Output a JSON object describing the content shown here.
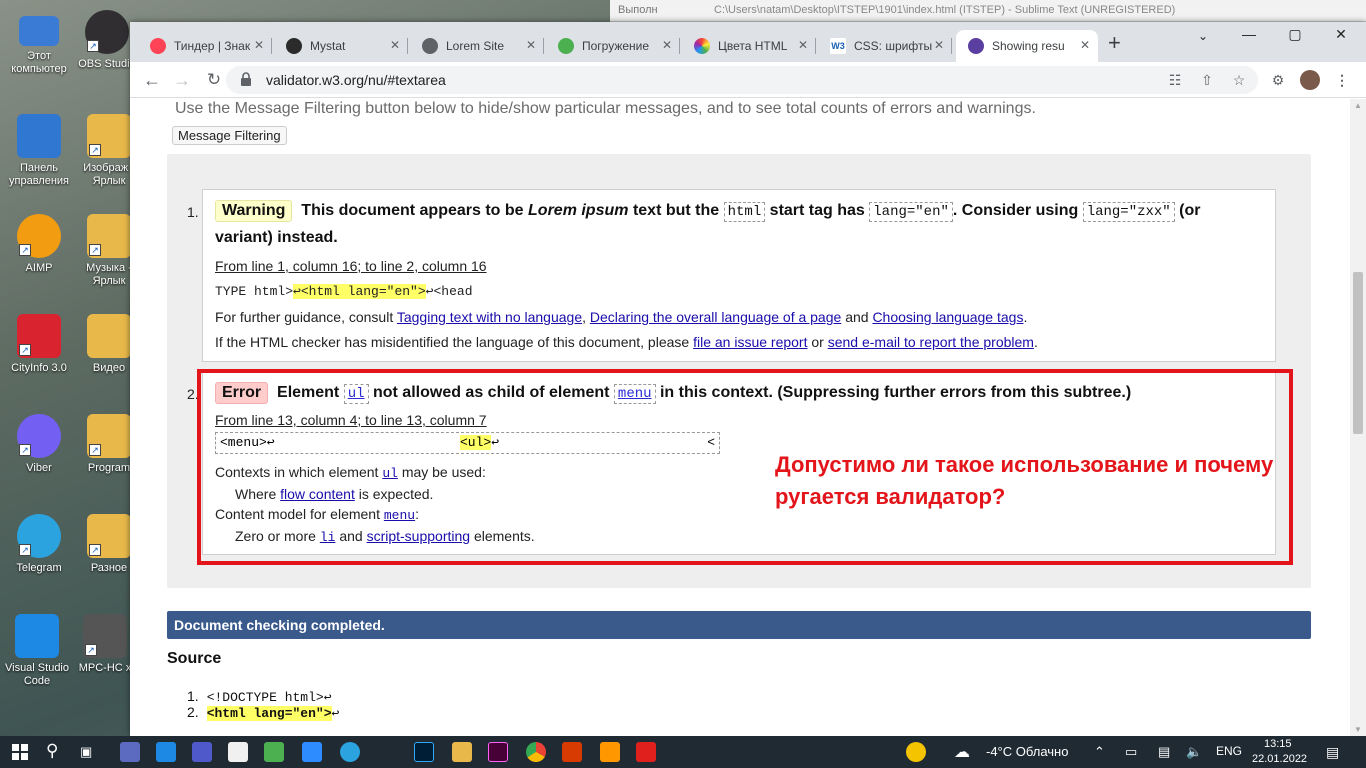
{
  "desktop": {
    "icons": [
      {
        "label": "Этот компьютер",
        "color": "#3a7bd5"
      },
      {
        "label": "OBS Studio",
        "color": "#302e31"
      },
      {
        "label": "Панель управления",
        "color": "#2f77d0"
      },
      {
        "label": "Изображ - Ярлык",
        "color": "#e8b84a"
      },
      {
        "label": "AIMP",
        "color": "#f29c11"
      },
      {
        "label": "Музыка - Ярлык",
        "color": "#e8b84a"
      },
      {
        "label": "CityInfo 3.0",
        "color": "#d9232e"
      },
      {
        "label": "Видео",
        "color": "#e8b84a"
      },
      {
        "label": "Viber",
        "color": "#7360f2"
      },
      {
        "label": "Program",
        "color": "#e8b84a"
      },
      {
        "label": "Telegram",
        "color": "#2aa3df"
      },
      {
        "label": "Разное",
        "color": "#e8b84a"
      },
      {
        "label": "Visual Studio Code",
        "color": "#1e88e5"
      },
      {
        "label": "MPC-HC x",
        "color": "#555555"
      }
    ]
  },
  "behind_window": {
    "tab1": "Выполн",
    "tab2": "C:\\Users\\natam\\Desktop\\ITSTEP\\1901\\index.html (ITSTEP) - Sublime Text (UNREGISTERED)"
  },
  "browser": {
    "tabs": [
      {
        "title": "Тиндер | Знак",
        "fav": "#ff4458",
        "active": false
      },
      {
        "title": "Mystat",
        "fav": "#2b2b2b",
        "active": false
      },
      {
        "title": "Lorem Site",
        "fav": "#5f6368",
        "active": false
      },
      {
        "title": "Погружение",
        "fav": "#4caf50",
        "active": false
      },
      {
        "title": "Цвета HTML",
        "fav": "#ff9800",
        "active": false
      },
      {
        "title": "CSS: шрифты",
        "fav": "#1a5fb4",
        "active": false
      },
      {
        "title": "Showing resu",
        "fav": "#5a3fa0",
        "active": true
      }
    ],
    "tab_close": "✕",
    "new_tab": "+",
    "window_controls": [
      "⌄",
      "—",
      "▢",
      "✕"
    ],
    "url": "validator.w3.org/nu/#textarea"
  },
  "page": {
    "intro": "Use the Message Filtering button below to hide/show particular messages, and to see total counts of errors and warnings.",
    "message_filtering": "Message Filtering",
    "messages": [
      {
        "num": "1.",
        "type": "Warning",
        "text_a": "This document appears to be",
        "text_em": "Lorem ipsum",
        "text_b": "text but the",
        "code1": "html",
        "text_c": "start tag has",
        "code2": "lang=\"en\"",
        "text_d": ". Consider using",
        "code3": "lang=\"zxx\"",
        "text_e": "(or",
        "text_line2": "variant) instead.",
        "location": "From line 1, column 16; to line 2, column 16",
        "extract_a": "TYPE html>",
        "extract_hl": "↩<html lang=\"en\">",
        "extract_b": "↩<head",
        "guidance_a": "For further guidance, consult",
        "guidance_l1": "Tagging text with no language",
        "guidance_l2": "Declaring the overall language of a page",
        "guidance_and": "and",
        "guidance_l3": "Choosing language tags",
        "misid_a": "If the HTML checker has misidentified the language of this document, please",
        "misid_l1": "file an issue report",
        "misid_or": "or",
        "misid_l2": "send e-mail to report the problem"
      },
      {
        "num": "2.",
        "type": "Error",
        "text_a": "Element",
        "code1": "ul",
        "text_b": "not allowed as child of element",
        "code2": "menu",
        "text_c": "in this context. (Suppressing further errors from this subtree.)",
        "location": "From line 13, column 4; to line 13, column 7",
        "extract_a": "<menu>↩",
        "extract_hl": "<ul>",
        "extract_b": "↩",
        "extract_c": "<",
        "contexts_a": "Contexts in which element",
        "contexts_code": "ul",
        "contexts_b": "may be used:",
        "where_a": "Where",
        "where_link": "flow content",
        "where_b": "is expected.",
        "model_a": "Content model for element",
        "model_code": "menu",
        "model_b": ":",
        "zero_a": "Zero or more",
        "zero_code": "li",
        "zero_and": "and",
        "zero_link": "script-supporting",
        "zero_b": "elements."
      }
    ],
    "annotation_line1": "Допустимо ли такое использование и почему",
    "annotation_line2": "ругается валидатор?",
    "completed": "Document checking completed.",
    "source_title": "Source",
    "source_lines": [
      {
        "num": "1.",
        "code": "<!DOCTYPE html>↩"
      },
      {
        "num": "2.",
        "code_hl": "<html lang=\"en\">",
        "code_b": "↩"
      }
    ]
  },
  "taskbar": {
    "weather": "-4°C  Облачно",
    "lang": "ENG",
    "time": "13:15",
    "date": "22.01.2022"
  }
}
